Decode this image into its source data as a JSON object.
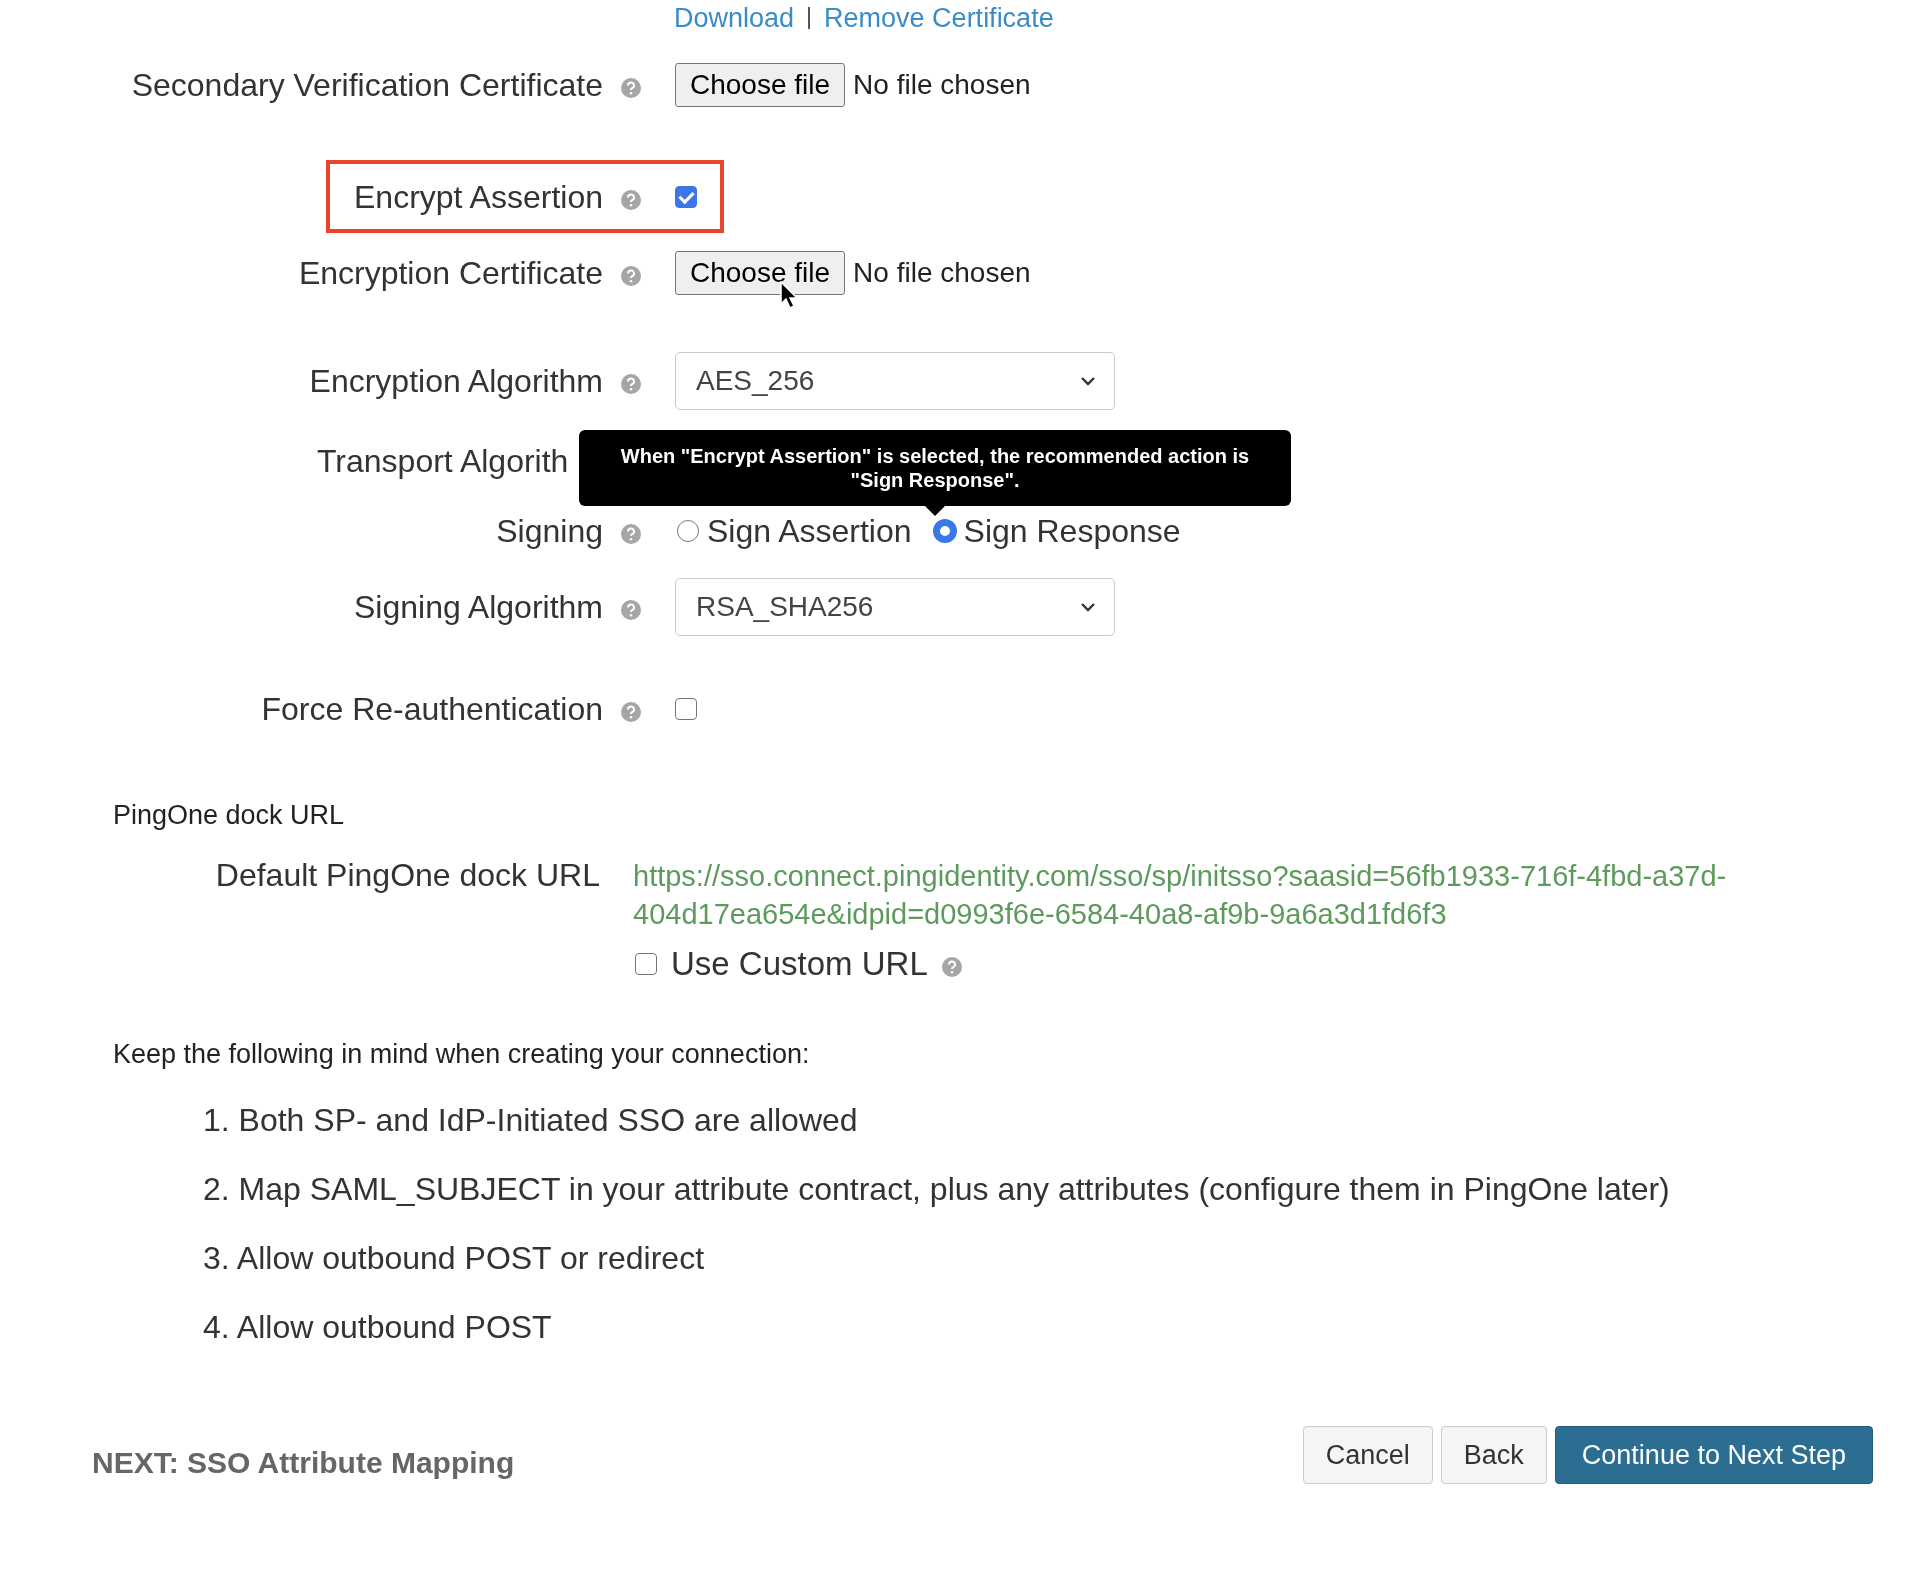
{
  "top_links": [
    {
      "label": "Download"
    },
    {
      "label": "Remove Certificate"
    }
  ],
  "fields": [
    {
      "kind": "file",
      "label": "Secondary Verification Certificate",
      "help": true,
      "button": "Choose file",
      "status": "No file chosen"
    },
    {
      "kind": "checkbox",
      "label": "Encrypt Assertion",
      "help": true,
      "checked": true,
      "highlighted": true
    },
    {
      "kind": "file",
      "label": "Encryption Certificate",
      "help": true,
      "button": "Choose file",
      "status": "No file chosen",
      "cursor": true
    },
    {
      "kind": "select",
      "label": "Encryption Algorithm",
      "help": true,
      "value": "AES_256"
    },
    {
      "kind": "label",
      "label": "Transport Algorith",
      "help": false
    },
    {
      "kind": "radio",
      "label": "Signing",
      "help": true,
      "options": [
        {
          "label": "Sign Assertion",
          "selected": false
        },
        {
          "label": "Sign Response",
          "selected": true
        }
      ]
    },
    {
      "kind": "select",
      "label": "Signing Algorithm",
      "help": true,
      "value": "RSA_SHA256"
    },
    {
      "kind": "checkbox",
      "label": "Force Re-authentication",
      "help": true,
      "checked": false,
      "highlighted": false
    }
  ],
  "tooltip": "When \"Encrypt Assertion\" is selected, the recommended action is \"Sign Response\".",
  "dock": {
    "heading": "PingOne dock URL",
    "label": "Default PingOne dock URL",
    "url": "https://sso.connect.pingidentity.com/sso/sp/initsso?saasid=56fb1933-716f-4fbd-a37d-404d17ea654e&idpid=d0993f6e-6584-40a8-af9b-9a6a3d1fd6f3",
    "custom": {
      "label": "Use Custom URL",
      "checked": false
    }
  },
  "notes": {
    "intro": "Keep the following in mind when creating your connection:",
    "items": [
      "1. Both SP- and IdP-Initiated SSO are allowed",
      "2. Map SAML_SUBJECT in your attribute contract, plus any attributes (configure them in PingOne later)",
      "3. Allow outbound POST or redirect",
      "4. Allow outbound POST"
    ]
  },
  "footer": {
    "next": "NEXT: SSO Attribute Mapping",
    "buttons": [
      {
        "label": "Cancel",
        "kind": "secondary"
      },
      {
        "label": "Back",
        "kind": "secondary"
      },
      {
        "label": "Continue to Next Step",
        "kind": "primary"
      }
    ]
  }
}
